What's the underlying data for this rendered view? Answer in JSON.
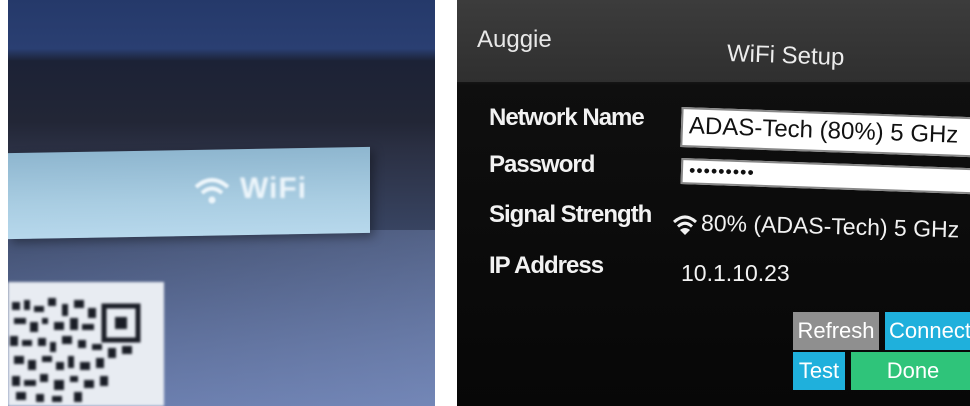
{
  "left_photo": {
    "wifi_label": "WiFi",
    "wifi_icon": "wifi-icon"
  },
  "device_screen": {
    "app_name": "Auggie",
    "title": "WiFi Setup",
    "fields": {
      "network_name_label": "Network Name",
      "network_name_value": "ADAS-Tech (80%) 5 GHz",
      "password_label": "Password",
      "password_value": "•••••••••",
      "signal_strength_label": "Signal Strength",
      "signal_strength_value": "80% (ADAS-Tech) 5 GHz",
      "signal_icon": "wifi-signal-icon",
      "ip_address_label": "IP Address",
      "ip_address_value": "10.1.10.23"
    },
    "buttons": {
      "refresh": "Refresh",
      "connect": "Connect",
      "test": "Test",
      "done": "Done"
    },
    "colors": {
      "connect": "#1fb0dc",
      "test": "#1fb0dc",
      "done": "#2fc47a",
      "refresh": "#8f8f8f"
    }
  }
}
